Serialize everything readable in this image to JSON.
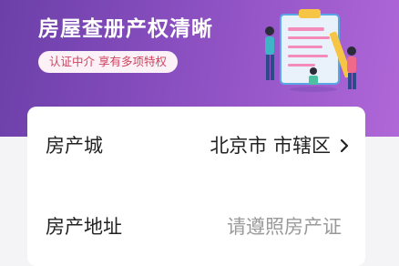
{
  "banner": {
    "title": "房屋查册产权清晰",
    "subtitle": "认证中介 享有多项特权",
    "illustration_icon": "clipboard-people-illustration",
    "colors": {
      "gradient_start": "#6b3fa8",
      "gradient_end": "#b067d8"
    }
  },
  "form": {
    "city": {
      "label": "房产城",
      "value": "北京市 市辖区",
      "chevron_icon": "chevron-right-icon"
    },
    "address": {
      "label": "房产地址",
      "placeholder": "请遵照房产证"
    }
  }
}
